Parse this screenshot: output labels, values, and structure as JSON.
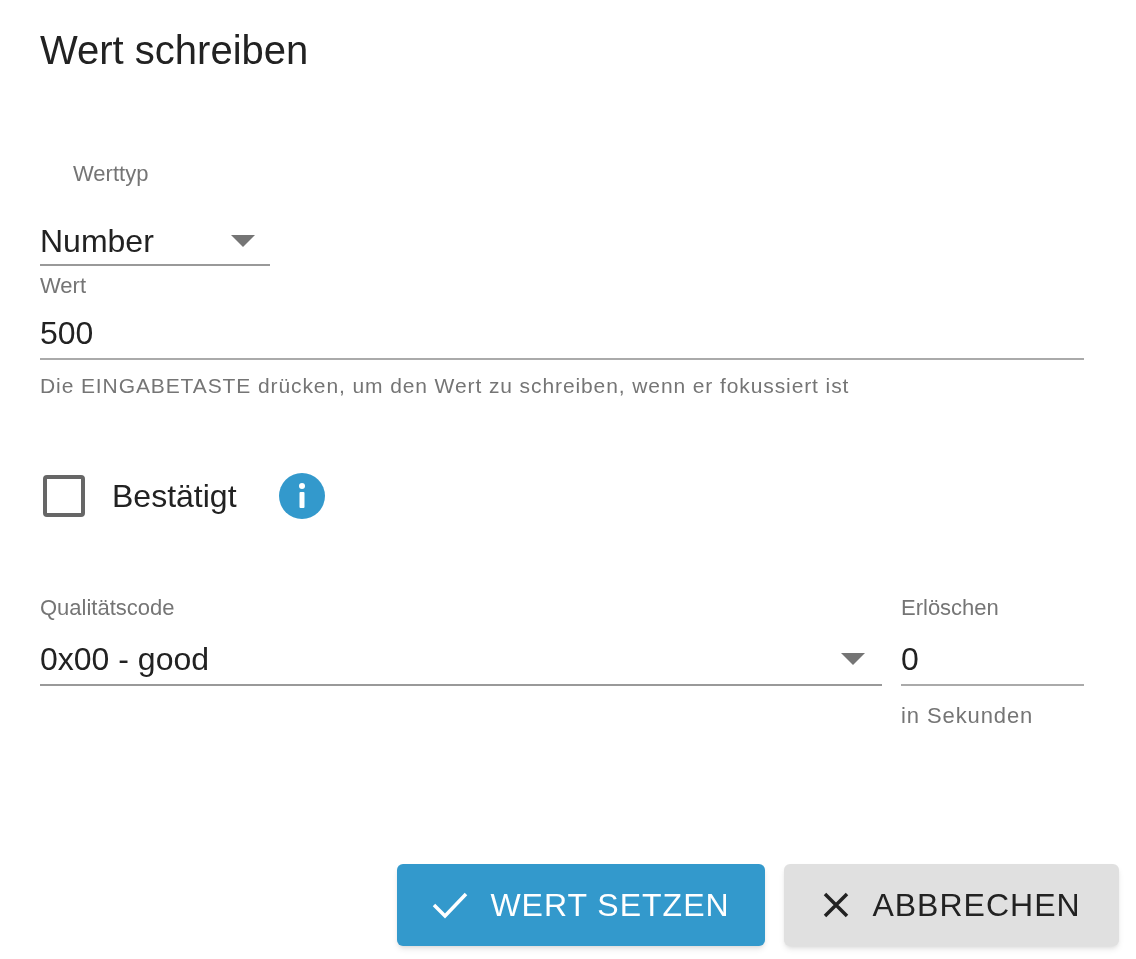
{
  "dialog": {
    "title": "Wert schreiben"
  },
  "value_type": {
    "label": "Werttyp",
    "value": "Number"
  },
  "value": {
    "label": "Wert",
    "value": "500",
    "helper": "Die EINGABETASTE drücken, um den Wert zu schreiben, wenn er fokussiert ist"
  },
  "confirmed": {
    "label": "Bestätigt",
    "checked": false
  },
  "quality": {
    "label": "Qualitätscode",
    "value": "0x00 - good"
  },
  "expire": {
    "label": "Erlöschen",
    "value": "0",
    "helper": "in Sekunden"
  },
  "buttons": [
    {
      "label": "WERT SETZEN",
      "kind": "primary"
    },
    {
      "label": "ABBRECHEN",
      "kind": "secondary"
    }
  ]
}
